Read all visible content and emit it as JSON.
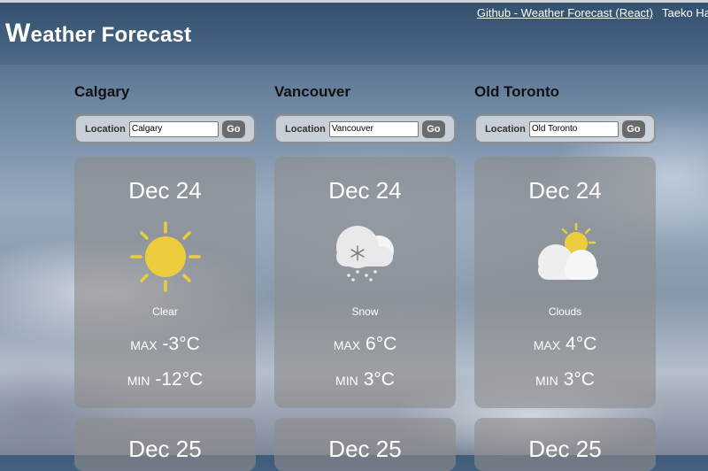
{
  "header": {
    "title_first": "W",
    "title_rest": "eather Forecast",
    "github_link": "Github - Weather Forecast (React)",
    "author": "Taeko Har"
  },
  "form": {
    "location_label": "Location",
    "go_label": "Go"
  },
  "columns": [
    {
      "city": "Calgary",
      "input_value": "Calgary",
      "card": {
        "date": "Dec 24",
        "icon": "sun-icon",
        "desc": "Clear",
        "max_label": "MAX",
        "max": "-3°C",
        "min_label": "MIN",
        "min": "-12°C"
      },
      "next_date": "Dec 25"
    },
    {
      "city": "Vancouver",
      "input_value": "Vancouver",
      "card": {
        "date": "Dec 24",
        "icon": "snow-icon",
        "desc": "Snow",
        "max_label": "MAX",
        "max": "6°C",
        "min_label": "MIN",
        "min": "3°C"
      },
      "next_date": "Dec 25"
    },
    {
      "city": "Old Toronto",
      "input_value": "Old Toronto",
      "card": {
        "date": "Dec 24",
        "icon": "clouds-icon",
        "desc": "Clouds",
        "max_label": "MAX",
        "max": "4°C",
        "min_label": "MIN",
        "min": "3°C"
      },
      "next_date": "Dec 25"
    }
  ],
  "colors": {
    "sun": "#edcd3e",
    "card_bg": "#8c8c8c",
    "button": "#6b6b6b"
  }
}
